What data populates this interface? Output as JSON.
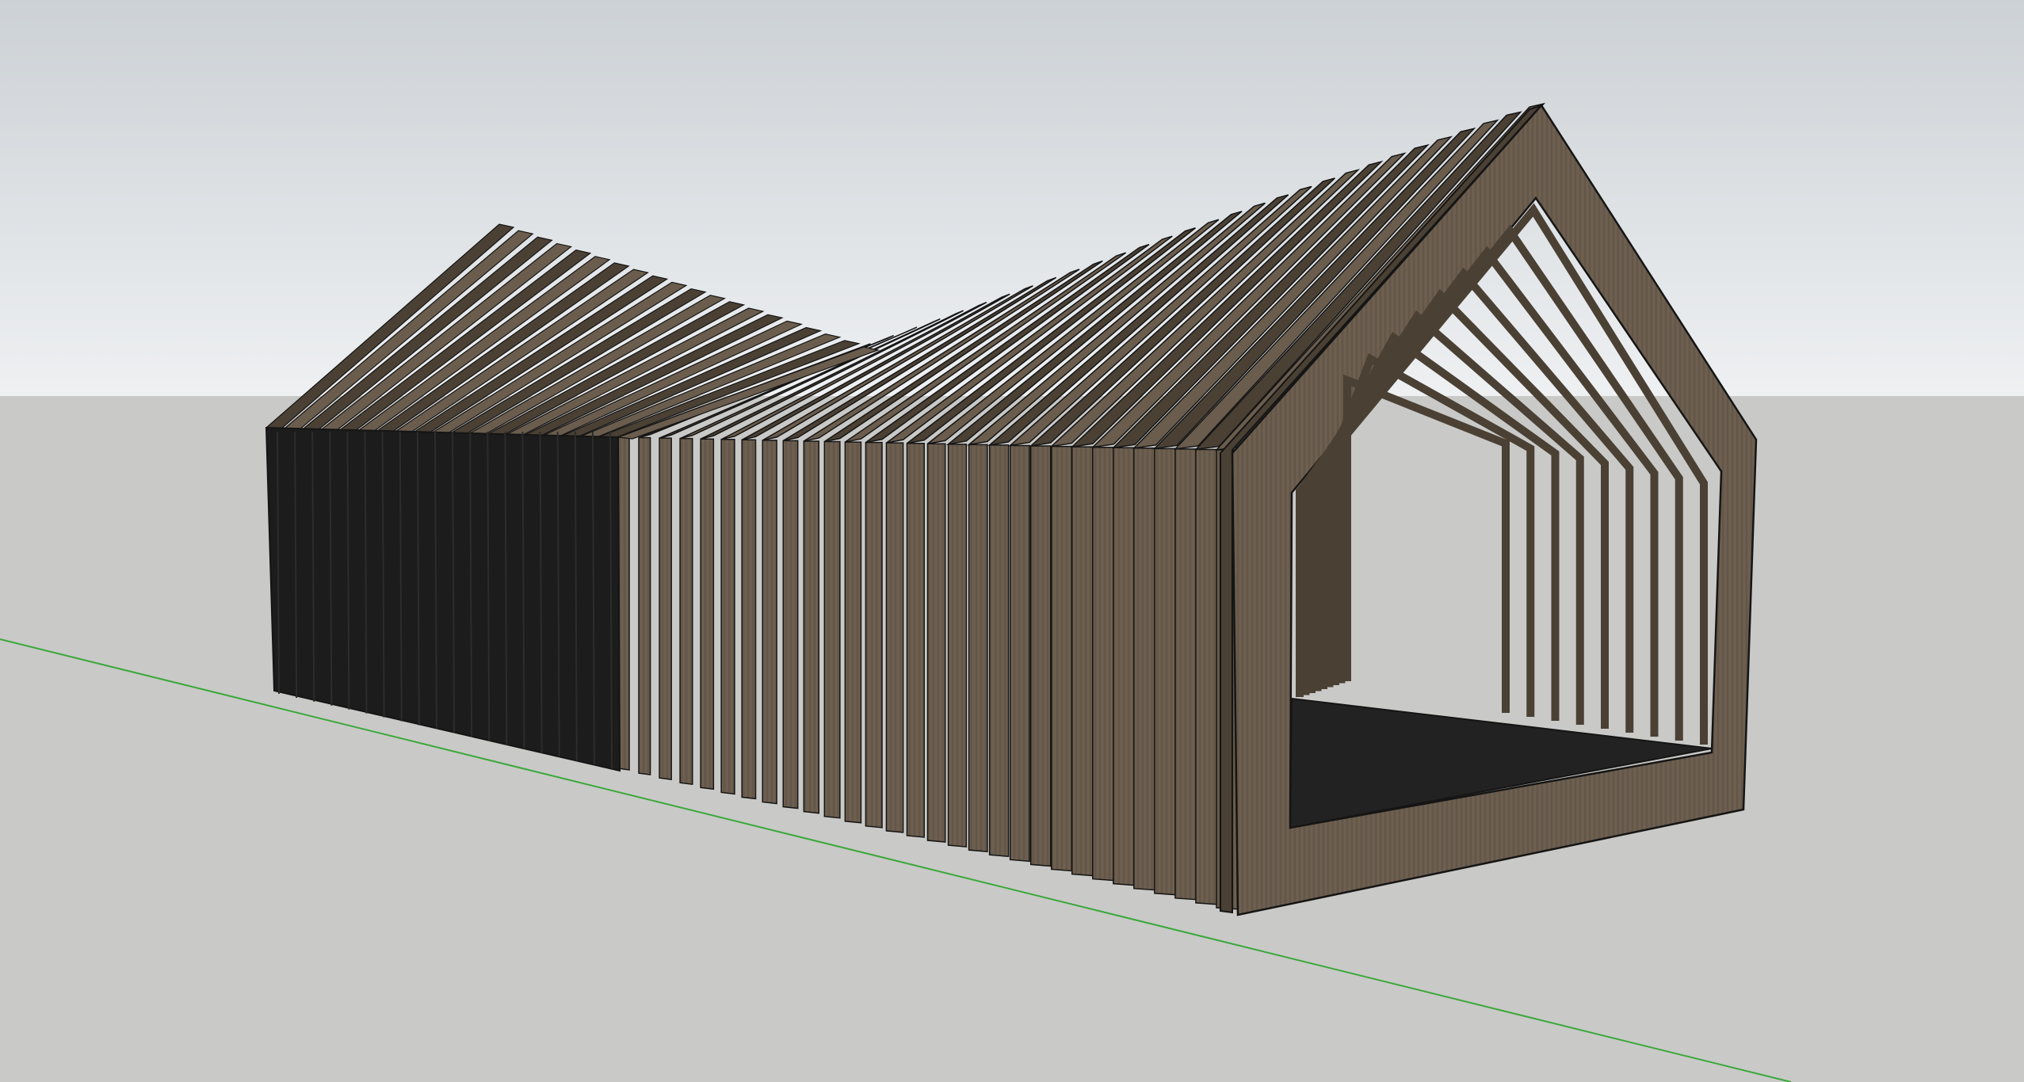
{
  "viewport": {
    "sky_top_color": "#ccd1d5",
    "sky_bottom_color": "#eef0f2",
    "ground_color": "#c9c9c7",
    "green_axis_color": "#3aa83a",
    "model": {
      "material_color": "#6b5d4d",
      "material_dark_color": "#4a4034",
      "shadow_color": "#1c1c1c",
      "edge_color": "#151515",
      "frame_count": 30
    }
  }
}
